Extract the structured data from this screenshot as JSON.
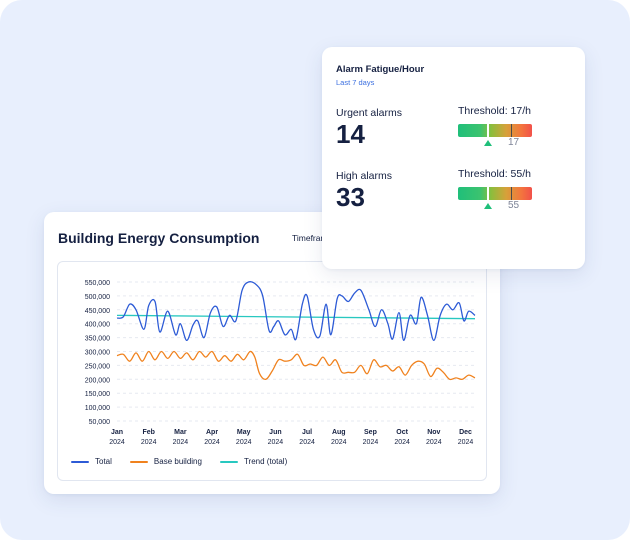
{
  "energy": {
    "title": "Building Energy Consumption",
    "timeframe_label": "Timeframe:"
  },
  "chart_data": {
    "type": "line",
    "title": "Building Energy Consumption",
    "xlabel": "",
    "ylabel": "",
    "ylim": [
      50000,
      550000
    ],
    "y_ticks": [
      "550,000",
      "500,000",
      "450,000",
      "400,000",
      "350,000",
      "300,000",
      "250,000",
      "200,000",
      "150,000",
      "100,000",
      "50,000"
    ],
    "x_ticks": [
      {
        "month": "Jan",
        "year": "2024"
      },
      {
        "month": "Feb",
        "year": "2024"
      },
      {
        "month": "Mar",
        "year": "2024"
      },
      {
        "month": "Apr",
        "year": "2024"
      },
      {
        "month": "May",
        "year": "2024"
      },
      {
        "month": "Jun",
        "year": "2024"
      },
      {
        "month": "Jul",
        "year": "2024"
      },
      {
        "month": "Aug",
        "year": "2024"
      },
      {
        "month": "Sep",
        "year": "2024"
      },
      {
        "month": "Oct",
        "year": "2024"
      },
      {
        "month": "Nov",
        "year": "2024"
      },
      {
        "month": "Dec",
        "year": "2024"
      }
    ],
    "grid": true,
    "legend_position": "bottom-left",
    "x_range": [
      0,
      11.3
    ],
    "series": [
      {
        "name": "Total",
        "color": "#2d5bd6",
        "x": [
          0,
          0.2,
          0.4,
          0.6,
          0.85,
          1.0,
          1.2,
          1.35,
          1.6,
          1.85,
          2.0,
          2.2,
          2.4,
          2.55,
          2.75,
          2.95,
          3.15,
          3.35,
          3.55,
          3.75,
          3.95,
          4.15,
          4.4,
          4.6,
          4.8,
          4.95,
          5.1,
          5.3,
          5.5,
          5.65,
          5.85,
          6.0,
          6.2,
          6.4,
          6.6,
          6.75,
          6.95,
          7.1,
          7.3,
          7.5,
          7.7,
          7.95,
          8.15,
          8.35,
          8.55,
          8.7,
          8.9,
          9.05,
          9.25,
          9.45,
          9.6,
          9.8,
          10.0,
          10.2,
          10.4,
          10.6,
          10.8,
          10.95,
          11.1,
          11.3
        ],
        "values": [
          420000,
          425000,
          470000,
          450000,
          380000,
          465000,
          480000,
          370000,
          445000,
          360000,
          400000,
          340000,
          395000,
          410000,
          350000,
          440000,
          460000,
          390000,
          430000,
          410000,
          520000,
          550000,
          540000,
          500000,
          375000,
          390000,
          410000,
          360000,
          380000,
          345000,
          470000,
          500000,
          380000,
          355000,
          470000,
          360000,
          490000,
          500000,
          480000,
          510000,
          520000,
          450000,
          390000,
          450000,
          400000,
          345000,
          440000,
          340000,
          430000,
          400000,
          495000,
          430000,
          340000,
          430000,
          470000,
          450000,
          475000,
          410000,
          445000,
          430000
        ]
      },
      {
        "name": "Base building",
        "color": "#f0821e",
        "x": [
          0,
          0.2,
          0.4,
          0.6,
          0.8,
          1.0,
          1.2,
          1.4,
          1.6,
          1.8,
          2.0,
          2.2,
          2.4,
          2.6,
          2.8,
          3.0,
          3.2,
          3.4,
          3.6,
          3.8,
          4.0,
          4.2,
          4.35,
          4.5,
          4.7,
          4.9,
          5.1,
          5.3,
          5.5,
          5.7,
          5.9,
          6.1,
          6.3,
          6.5,
          6.7,
          6.9,
          7.1,
          7.3,
          7.5,
          7.7,
          7.9,
          8.1,
          8.3,
          8.5,
          8.7,
          8.9,
          9.1,
          9.3,
          9.5,
          9.7,
          9.9,
          10.1,
          10.3,
          10.5,
          10.7,
          10.9,
          11.1,
          11.3
        ],
        "values": [
          285000,
          290000,
          265000,
          295000,
          265000,
          300000,
          270000,
          300000,
          275000,
          300000,
          275000,
          295000,
          270000,
          300000,
          280000,
          300000,
          265000,
          285000,
          265000,
          290000,
          270000,
          300000,
          280000,
          220000,
          200000,
          230000,
          270000,
          265000,
          270000,
          290000,
          250000,
          255000,
          250000,
          280000,
          250000,
          270000,
          225000,
          225000,
          225000,
          250000,
          220000,
          270000,
          245000,
          250000,
          230000,
          245000,
          215000,
          250000,
          265000,
          255000,
          210000,
          240000,
          225000,
          200000,
          205000,
          200000,
          215000,
          205000
        ]
      },
      {
        "name": "Trend (total)",
        "color": "#28c8c0",
        "x": [
          0,
          11.3
        ],
        "values": [
          430000,
          418000
        ]
      }
    ]
  },
  "alarms": {
    "title": "Alarm Fatigue/Hour",
    "subtitle": "Last 7 days",
    "metrics": [
      {
        "label": "Urgent alarms",
        "value": "14",
        "threshold_label": "Threshold: 17/h",
        "gauge_value": "17",
        "fill_fraction": 0.41
      },
      {
        "label": "High alarms",
        "value": "33",
        "threshold_label": "Threshold: 55/h",
        "gauge_value": "55",
        "fill_fraction": 0.41
      }
    ]
  }
}
